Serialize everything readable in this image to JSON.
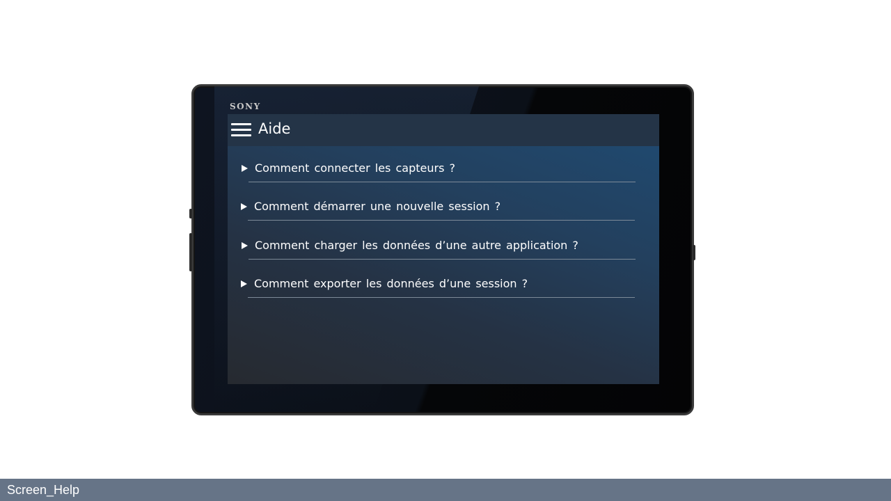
{
  "device": {
    "brand": "SONY"
  },
  "app_bar": {
    "menu_icon": "hamburger-menu-icon",
    "title": "Aide"
  },
  "faq": [
    {
      "question": "Comment connecter les capteurs ?"
    },
    {
      "question": "Comment démarrer une nouvelle session ?"
    },
    {
      "question": "Comment charger les données d’une autre application ?"
    },
    {
      "question": "Comment exporter les données d’une session ?"
    }
  ],
  "footer": {
    "screen_name": "Screen_Help"
  },
  "colors": {
    "app_bar": "#243447",
    "screen_top": "#1f4b73",
    "screen_bottom": "#262a30",
    "footer": "#667487",
    "divider": "#7d8a98"
  }
}
